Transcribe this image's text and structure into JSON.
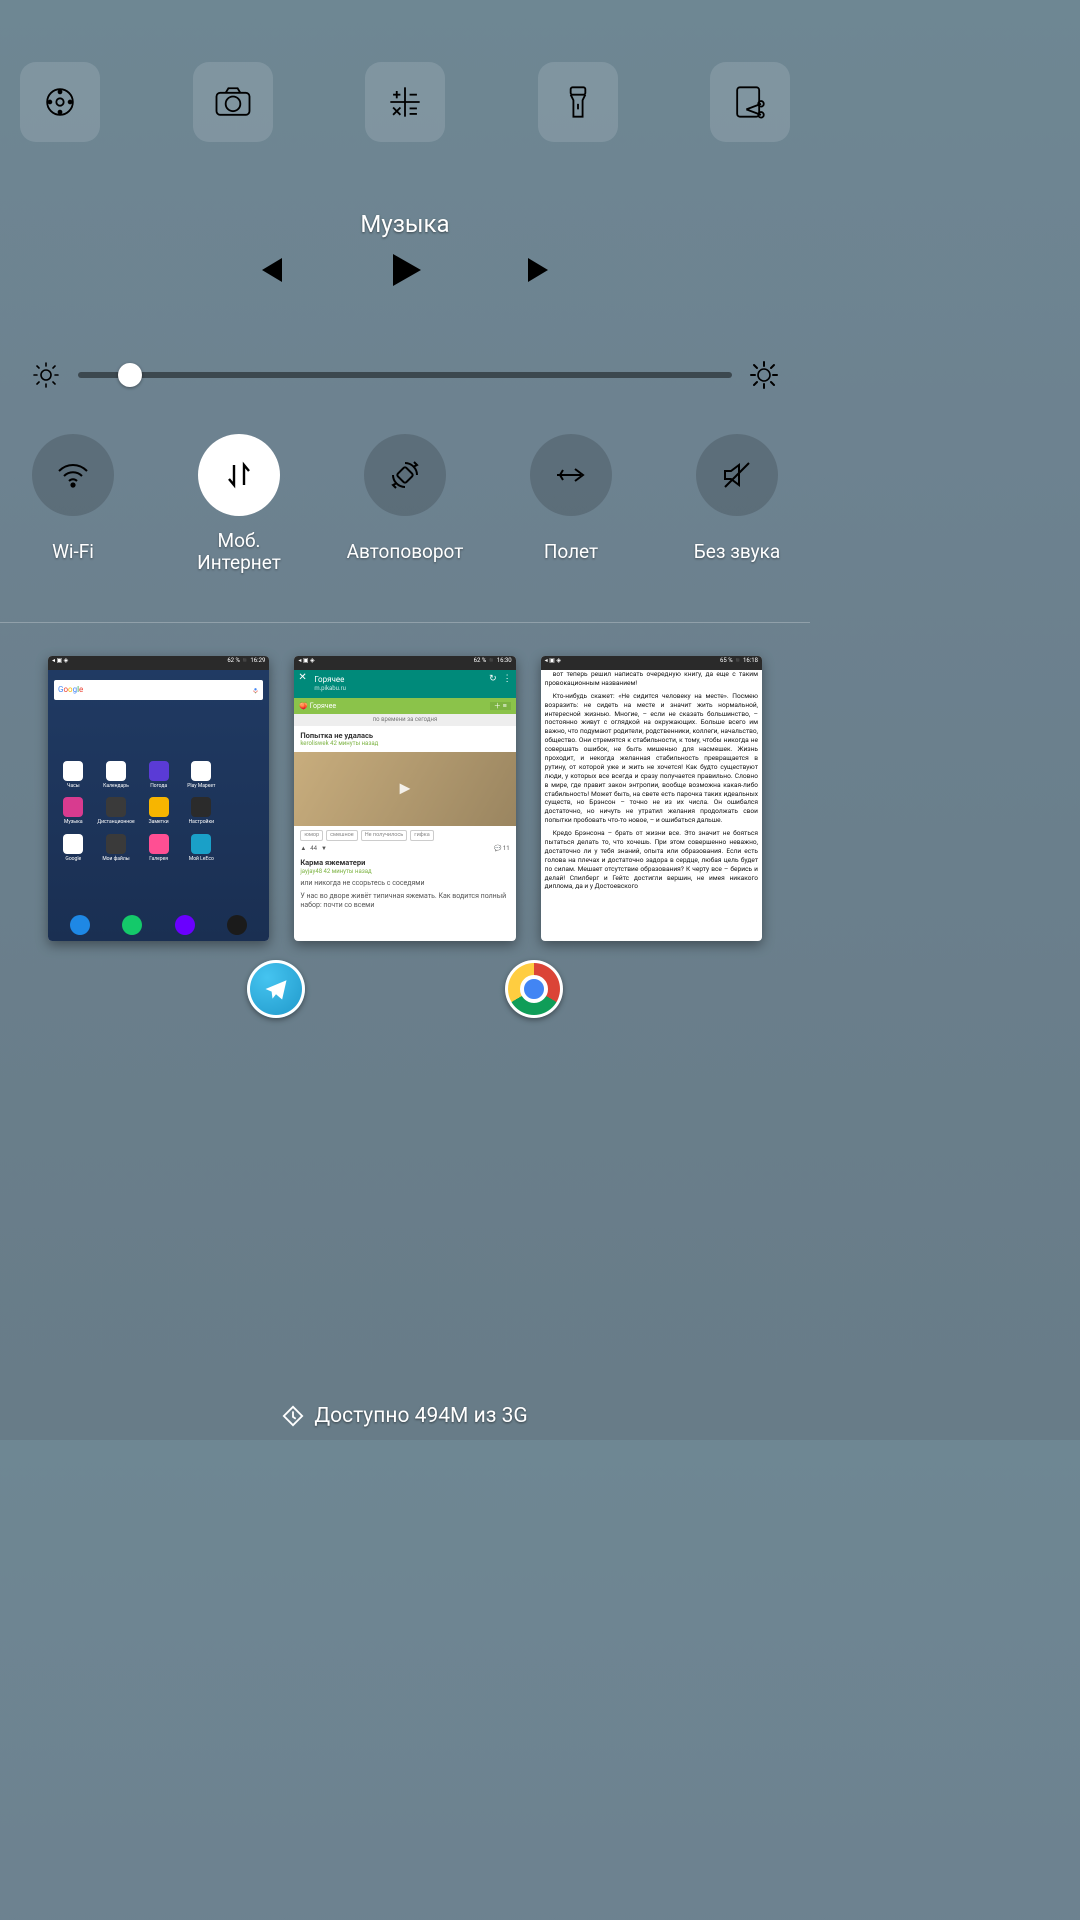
{
  "shortcuts": [
    "remote",
    "camera",
    "calculator",
    "flashlight",
    "screenshot"
  ],
  "music": {
    "title": "Музыка"
  },
  "brightness": {
    "percent": 8
  },
  "toggles": [
    {
      "id": "wifi",
      "label": "Wi-Fi",
      "on": false
    },
    {
      "id": "mobile-data",
      "label": "Моб. Интернет",
      "on": true
    },
    {
      "id": "autorotate",
      "label": "Автоповорот",
      "on": false
    },
    {
      "id": "airplane",
      "label": "Полет",
      "on": false
    },
    {
      "id": "mute",
      "label": "Без звука",
      "on": false
    }
  ],
  "recents": {
    "launcher": {
      "status_right": "62 % ◾ 16:29",
      "search_brand": "Google",
      "icons": [
        {
          "l": "Часы",
          "c": "#ffffff"
        },
        {
          "l": "Календарь",
          "c": "#ffffff"
        },
        {
          "l": "Погода",
          "c": "#5a3bd6"
        },
        {
          "l": "Play Маркет",
          "c": "#ffffff"
        },
        {
          "l": "",
          "c": "transparent"
        },
        {
          "l": "Музыка",
          "c": "#d83b8f"
        },
        {
          "l": "Дистанционное",
          "c": "#3a3a3a"
        },
        {
          "l": "Заметки",
          "c": "#f7b500"
        },
        {
          "l": "Настройки",
          "c": "#2b2b2b"
        },
        {
          "l": "",
          "c": "transparent"
        },
        {
          "l": "Google",
          "c": "#ffffff"
        },
        {
          "l": "Мои файлы",
          "c": "#3a3a3a"
        },
        {
          "l": "Галерея",
          "c": "#ff4f93"
        },
        {
          "l": "Мой LeEco",
          "c": "#1aa0c8"
        },
        {
          "l": "",
          "c": "transparent"
        }
      ],
      "dock": [
        "#1e88e5",
        "#14c96a",
        "#6a00ff",
        "#1b1b1b"
      ]
    },
    "pikabu": {
      "status_right": "62 % ◾ 16:30",
      "header_title": "Горячее",
      "header_sub": "m.pikabu.ru",
      "tab_label": "Горячее",
      "sort_label": "по времени за сегодня",
      "post1_title": "Попытка не удалась",
      "post1_meta": "keroliswek 42 минуты назад",
      "tags": [
        "юмор",
        "смешное",
        "Не получилось",
        "гифка"
      ],
      "votes": "44",
      "comments": "11",
      "post2_title": "Карма яжематери",
      "post2_meta": "jayjay48 42 минуты назад",
      "post2_l1": "или никогда не ссорьтесь с соседями",
      "post2_l2": "У нас во дворе живёт типичная яжемать. Как водится полный набор: почти со всеми"
    },
    "reader": {
      "status_right": "65 % ◾ 16:18",
      "p1": "вот теперь решил написать очередную книгу, да еще с таким провокационным названием!",
      "p2": "Кто-нибудь скажет: «Не сидится человеку на месте». Посмею возразить: не сидеть на месте и значит жить нормальной, интересной жизнью. Многие, – если не сказать большинство, – постоянно живут с оглядкой на окружающих. Больше всего им важно, что подумают родители, родственники, коллеги, начальство, общество. Они стремятся к стабильности, к тому, чтобы никогда не совершать ошибок, не быть мишенью для насмешек. Жизнь проходит, и некогда желанная стабильность превращается в рутину, от которой уже и жить не хочется! Как будто существуют люди, у которых все всегда и сразу получается правильно. Словно в мире, где правит закон энтропии, вообще возможна какая-либо стабильность! Может быть, на свете есть парочка таких идеальных существ, но Брэнсон – точно не из их числа. Он ошибался достаточно, но ничуть не утратил желания продолжать свои попытки пробовать что-то новое, – и ошибаться дальше.",
      "p3": "Кредо Брэнсона – брать от жизни все. Это значит не бояться пытаться делать то, что хочешь. При этом совершенно неважно, достаточно ли у тебя знаний, опыта или образования. Если есть голова на плечах и достаточно задора в сердце, любая цель будет по силам. Мешает отсутствие образования? К черту все – берись и делай! Спилберг и Гейтс достигли вершин, не имея никакого диплома, да и у Достоевского"
    }
  },
  "apps": [
    "telegram",
    "chrome"
  ],
  "memory": {
    "text": "Доступно 494M из 3G"
  }
}
